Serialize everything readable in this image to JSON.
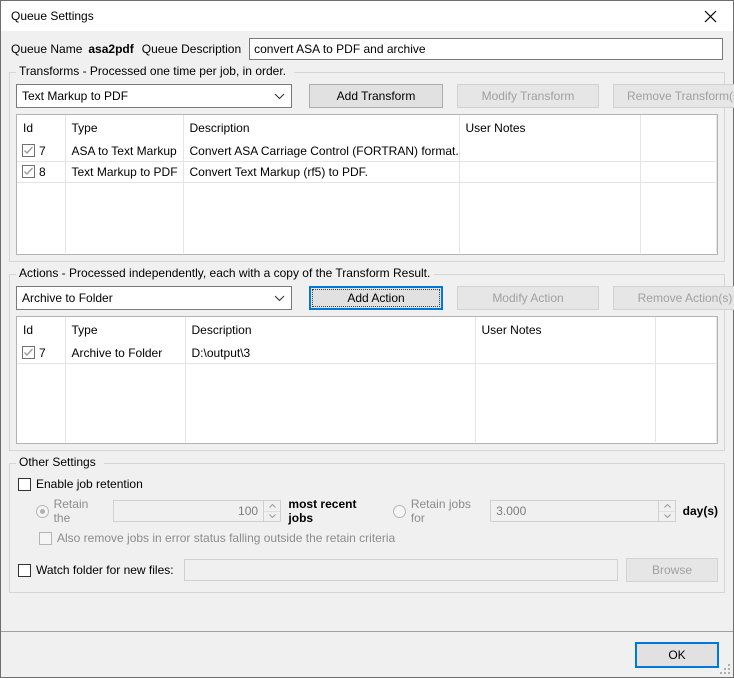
{
  "window": {
    "title": "Queue Settings",
    "close_icon": "close-icon"
  },
  "header_fields": {
    "queue_name_label": "Queue Name",
    "queue_name_value": "asa2pdf",
    "queue_description_label": "Queue Description",
    "queue_description_value": "convert ASA to PDF and archive",
    "queue_description_placeholder": ""
  },
  "transforms": {
    "legend": "Transforms - Processed one time per job, in order.",
    "combo_value": "Text Markup to PDF",
    "add_label": "Add Transform",
    "modify_label": "Modify Transform",
    "remove_label": "Remove Transform(s)",
    "columns": [
      "Id",
      "Type",
      "Description",
      "User Notes",
      ""
    ],
    "rows": [
      {
        "checked": true,
        "id": "7",
        "type": "ASA to Text Markup",
        "description": "Convert ASA Carriage Control (FORTRAN) format...",
        "user_notes": "",
        "extra": ""
      },
      {
        "checked": true,
        "id": "8",
        "type": "Text Markup to PDF",
        "description": "Convert Text Markup (rf5) to PDF.",
        "user_notes": "",
        "extra": ""
      }
    ]
  },
  "actions": {
    "legend": "Actions - Processed independently, each with a copy of the Transform Result.",
    "combo_value": "Archive to Folder",
    "add_label": "Add Action",
    "modify_label": "Modify Action",
    "remove_label": "Remove Action(s)",
    "columns": [
      "Id",
      "Type",
      "Description",
      "User Notes",
      ""
    ],
    "rows": [
      {
        "checked": true,
        "id": "7",
        "type": "Archive to Folder",
        "description": "D:\\output\\3",
        "user_notes": "",
        "extra": ""
      }
    ]
  },
  "other_settings": {
    "legend": "Other Settings",
    "enable_job_retention_label": "Enable job retention",
    "enable_job_retention_checked": false,
    "retain_the_label": "Retain the",
    "retain_the_selected": true,
    "retain_count_value": "100",
    "most_recent_jobs_label": "most recent jobs",
    "retain_jobs_for_label": "Retain jobs for",
    "retain_jobs_for_selected": false,
    "retain_days_value": "3.000",
    "days_label": "day(s)",
    "also_remove_label": "Also remove jobs in error status falling outside the retain criteria",
    "also_remove_checked": false,
    "watch_folder_label": "Watch folder for new files:",
    "watch_folder_checked": false,
    "watch_folder_value": "",
    "browse_label": "Browse"
  },
  "footer": {
    "ok_label": "OK"
  },
  "colors": {
    "accent": "#0078d7",
    "window_bg": "#f0f0f0",
    "grid_line": "#e4e4e4"
  }
}
